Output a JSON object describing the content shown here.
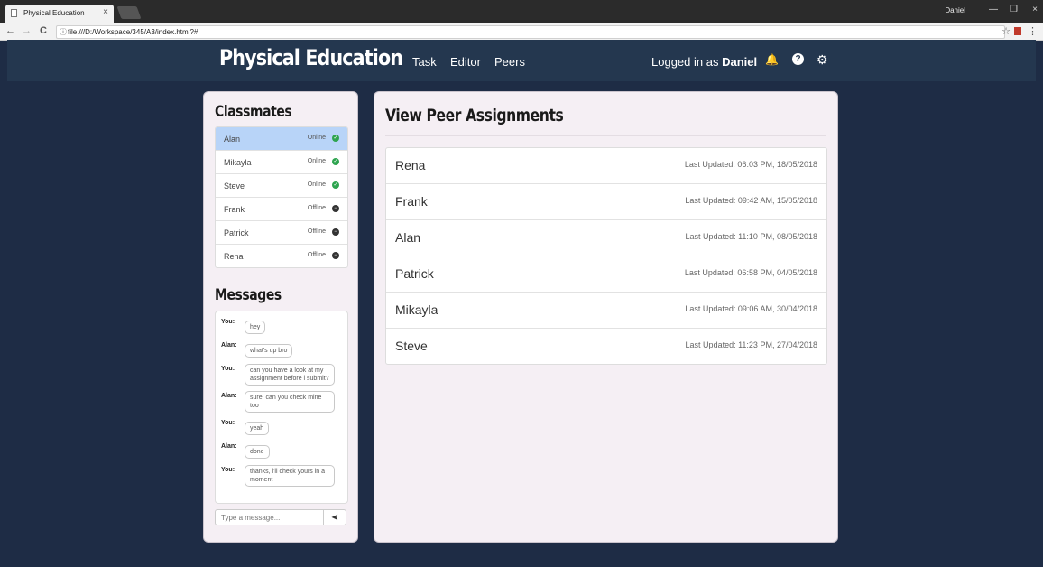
{
  "browser": {
    "tab_title": "Physical Education",
    "tab_close": "×",
    "url": "file:///D:/Workspace/345/A3/index.html?#",
    "window_user": "Daniel",
    "controls": {
      "minimize": "—",
      "restore": "❐",
      "close": "×"
    },
    "nav": {
      "back": "←",
      "forward": "→",
      "reload": "C"
    },
    "info_glyph": "ⓘ",
    "star_glyph": "☆",
    "menu_glyph": "⋮"
  },
  "header": {
    "brand": "Physical Education",
    "nav": [
      "Task",
      "Editor",
      "Peers"
    ],
    "logged_in_prefix": "Logged in as",
    "username": "Daniel",
    "bell_glyph": "🔔",
    "help_glyph": "?",
    "gear_glyph": "⚙"
  },
  "classmates": {
    "title": "Classmates",
    "items": [
      {
        "name": "Alan",
        "status": "Online",
        "active": true
      },
      {
        "name": "Mikayla",
        "status": "Online",
        "active": false
      },
      {
        "name": "Steve",
        "status": "Online",
        "active": false
      },
      {
        "name": "Frank",
        "status": "Offline",
        "active": false
      },
      {
        "name": "Patrick",
        "status": "Offline",
        "active": false
      },
      {
        "name": "Rena",
        "status": "Offline",
        "active": false
      }
    ]
  },
  "messages": {
    "title": "Messages",
    "items": [
      {
        "from": "You:",
        "text": "hey"
      },
      {
        "from": "Alan:",
        "text": "what's up bro"
      },
      {
        "from": "You:",
        "text": "can you have a look at my assignment before i submit?"
      },
      {
        "from": "Alan:",
        "text": "sure, can you check mine too"
      },
      {
        "from": "You:",
        "text": "yeah"
      },
      {
        "from": "Alan:",
        "text": "done"
      },
      {
        "from": "You:",
        "text": "thanks, i'll check yours in a moment"
      }
    ],
    "input_placeholder": "Type a message...",
    "send_glyph": "➤"
  },
  "peers": {
    "title": "View Peer Assignments",
    "items": [
      {
        "name": "Rena",
        "updated": "Last Updated: 06:03 PM, 18/05/2018"
      },
      {
        "name": "Frank",
        "updated": "Last Updated: 09:42 AM, 15/05/2018"
      },
      {
        "name": "Alan",
        "updated": "Last Updated: 11:10 PM, 08/05/2018"
      },
      {
        "name": "Patrick",
        "updated": "Last Updated: 06:58 PM, 04/05/2018"
      },
      {
        "name": "Mikayla",
        "updated": "Last Updated: 09:06 AM, 30/04/2018"
      },
      {
        "name": "Steve",
        "updated": "Last Updated: 11:23 PM, 27/04/2018"
      }
    ]
  },
  "colors": {
    "online": "#2ea44f",
    "offline": "#333333",
    "active_row": "#b8d4f8",
    "header_bg": "#24374f"
  }
}
